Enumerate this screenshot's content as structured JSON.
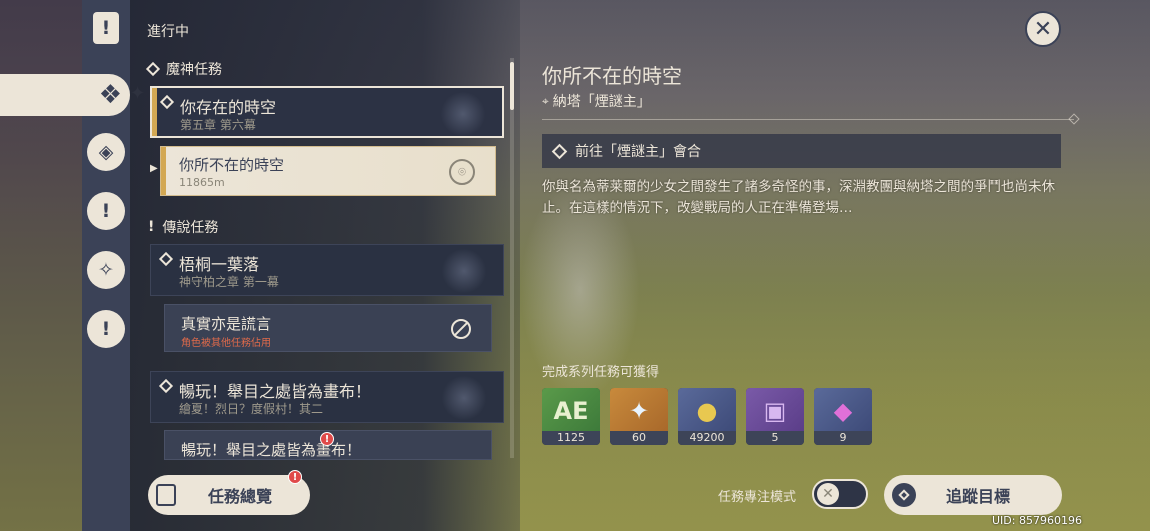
{
  "header": {
    "in_progress": "進行中",
    "close_icon": "✕"
  },
  "categories": [
    {
      "icon": "bookmark-icon"
    },
    {
      "icon": "archon-quest-icon",
      "selected": true
    },
    {
      "icon": "story-quest-icon"
    },
    {
      "icon": "world-quest-icon"
    },
    {
      "icon": "commission-icon"
    },
    {
      "icon": "event-quest-icon"
    }
  ],
  "sections": {
    "archon": "魔神任務",
    "legend": "傳說任務"
  },
  "quests": [
    {
      "title": "你存在的時空",
      "subtitle": "第五章 第六幕"
    },
    {
      "title": "你所不在的時空",
      "subtitle": "11865m"
    },
    {
      "title": "梧桐一葉落",
      "subtitle": "神守柏之章 第一幕"
    },
    {
      "title": "真實亦是謊言",
      "subtitle": "角色被其他任務佔用"
    },
    {
      "title": "暢玩！舉目之處皆為畫布！",
      "subtitle": "繪夏！烈日？度假村！其二"
    },
    {
      "title": "暢玩！舉目之處皆為畫布！",
      "subtitle": ""
    }
  ],
  "detail": {
    "title": "你所不在的時空",
    "location": "納塔「煙謎主」",
    "objective": "前往「煙謎主」會合",
    "description": "你與名為蒂莱爾的少女之間發生了諸多奇怪的事，深淵教團與納塔之間的爭鬥也尚未休止。在這樣的情況下，改變戰局的人正在準備登場…",
    "rewards_label": "完成系列任務可獲得",
    "rewards": [
      {
        "icon": "adventure-exp-icon",
        "count": "1125"
      },
      {
        "icon": "primogem-icon",
        "count": "60"
      },
      {
        "icon": "mora-icon",
        "count": "49200"
      },
      {
        "icon": "heros-wit-icon",
        "count": "5"
      },
      {
        "icon": "enhancement-ore-icon",
        "count": "9"
      }
    ]
  },
  "footer": {
    "overview_label": "任務總覽",
    "badge": "!",
    "focus_mode_label": "任務專注模式",
    "track_label": "追蹤目標",
    "uid": "UID: 857960196"
  },
  "colors": {
    "accent": "#ece5d8",
    "panel": "#3b4257",
    "gold": "#d3a853",
    "alert": "#e04a4a"
  }
}
